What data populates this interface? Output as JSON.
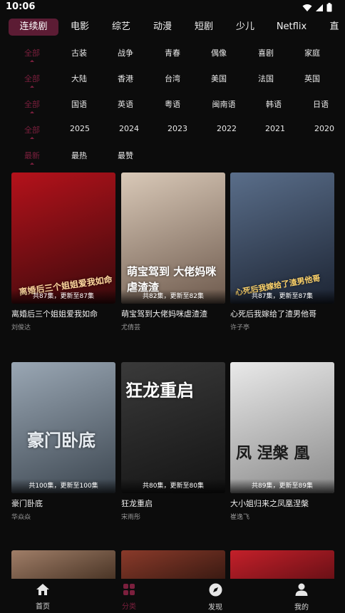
{
  "status": {
    "time": "10:06"
  },
  "tabs": [
    "连续剧",
    "电影",
    "综艺",
    "动漫",
    "短剧",
    "少儿",
    "Netflix",
    "直"
  ],
  "filters": [
    {
      "items": [
        "全部",
        "古装",
        "战争",
        "青春",
        "偶像",
        "喜剧",
        "家庭"
      ]
    },
    {
      "items": [
        "全部",
        "大陆",
        "香港",
        "台湾",
        "美国",
        "法国",
        "英国"
      ]
    },
    {
      "items": [
        "全部",
        "国语",
        "英语",
        "粤语",
        "闽南语",
        "韩语",
        "日语"
      ]
    },
    {
      "items": [
        "全部",
        "2025",
        "2024",
        "2023",
        "2022",
        "2021",
        "2020"
      ]
    },
    {
      "items": [
        "最新",
        "最热",
        "最赞"
      ]
    }
  ],
  "cards": [
    {
      "title": "离婚后三个姐姐爱我如命",
      "actor": "刘俊达",
      "episodes": "共87集，更新至87集",
      "poster_text": "离婚后三个姐姐爱我如命",
      "colors": [
        "#b5121b",
        "#3a0a0c"
      ]
    },
    {
      "title": "萌宝驾到大佬妈咪虐渣渣",
      "actor": "尤倩芸",
      "episodes": "共82集，更新至82集",
      "poster_text": "萌宝驾到 大佬妈咪虐渣渣",
      "colors": [
        "#d9c9b8",
        "#6e5a4d"
      ]
    },
    {
      "title": "心死后我嫁给了渣男他哥",
      "actor": "许子亭",
      "episodes": "共87集，更新至87集",
      "poster_text": "心死后我嫁给了渣男他哥",
      "colors": [
        "#5a6e8a",
        "#1c2433"
      ]
    },
    {
      "title": "豪门卧底",
      "actor": "华焱焱",
      "episodes": "共100集，更新至100集",
      "poster_text": "豪门卧底",
      "colors": [
        "#9aa7b4",
        "#3c4650"
      ]
    },
    {
      "title": "狂龙重启",
      "actor": "宋雨彤",
      "episodes": "共80集，更新至80集",
      "poster_text": "狂龙重启",
      "colors": [
        "#3a3a3a",
        "#141414"
      ]
    },
    {
      "title": "大小姐归来之凤凰涅槃",
      "actor": "崔逸飞",
      "episodes": "共89集，更新至89集",
      "poster_text": "凤 涅槃 凰",
      "colors": [
        "#e9e9e9",
        "#8a8a8a"
      ]
    }
  ],
  "partial_cards": [
    {
      "colors": [
        "#a07e68",
        "#4a3526"
      ]
    },
    {
      "colors": [
        "#8a3a2a",
        "#3a1a12"
      ]
    },
    {
      "colors": [
        "#c4202a",
        "#6a1016"
      ]
    }
  ],
  "bottom_nav": [
    {
      "label": "首页",
      "icon": "home-icon"
    },
    {
      "label": "分类",
      "icon": "category-icon"
    },
    {
      "label": "发现",
      "icon": "compass-icon"
    },
    {
      "label": "我的",
      "icon": "profile-icon"
    }
  ],
  "accent": "#7b1f3d"
}
